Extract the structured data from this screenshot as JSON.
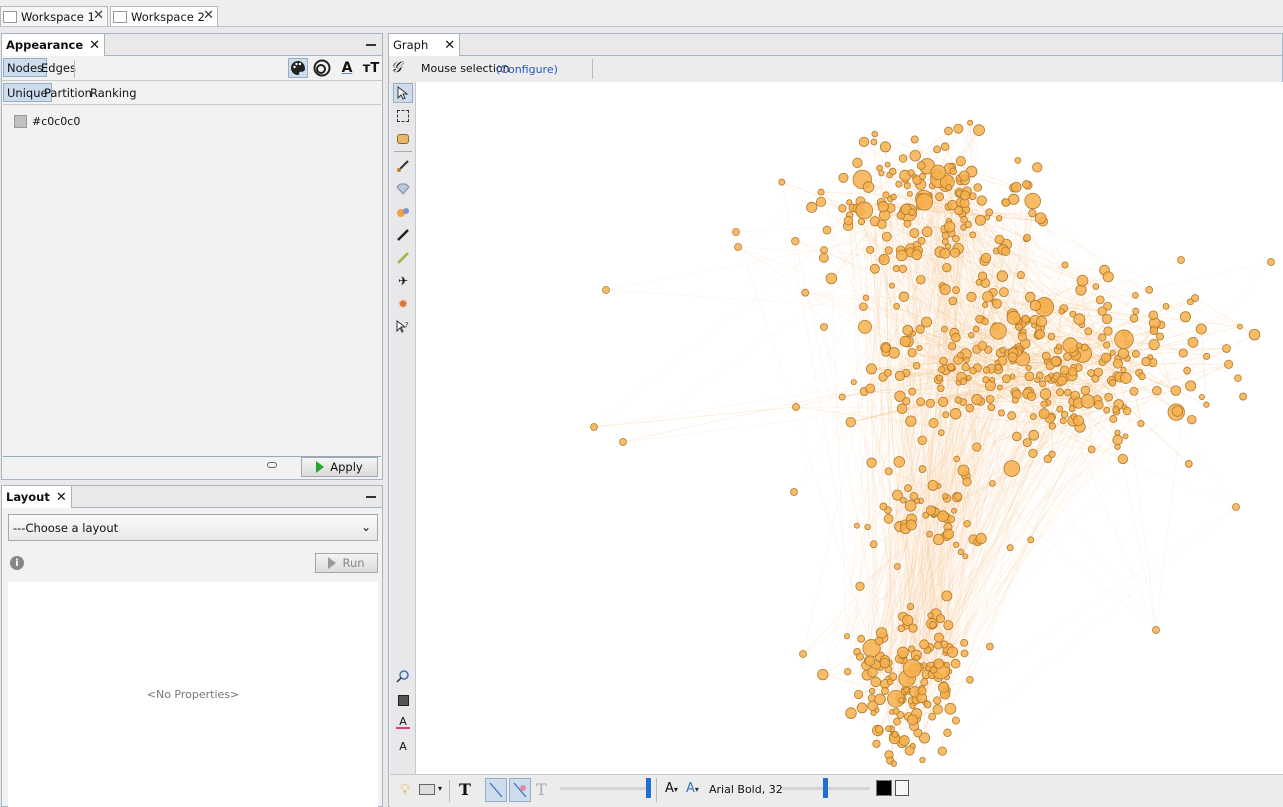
{
  "workspaces": [
    {
      "label": "Workspace 1",
      "active": false
    },
    {
      "label": "Workspace 2",
      "active": true
    }
  ],
  "appearance": {
    "title": "Appearance",
    "tabs": [
      "Nodes",
      "Edges"
    ],
    "modes": [
      "Unique",
      "Partition",
      "Ranking"
    ],
    "color_value": "#c0c0c0",
    "apply_label": "Apply"
  },
  "layout": {
    "title": "Layout",
    "select_value": "---Choose a layout",
    "run_label": "Run",
    "no_properties": "<No Properties>"
  },
  "graph": {
    "tab_label": "Graph",
    "mode_label": "Mouse selection",
    "configure_link": "(Configure)",
    "font_label": "Arial Bold, 32",
    "node_color": "#f7b04e",
    "node_stroke": "#b07a2c",
    "edge_color": "#f6c892"
  }
}
